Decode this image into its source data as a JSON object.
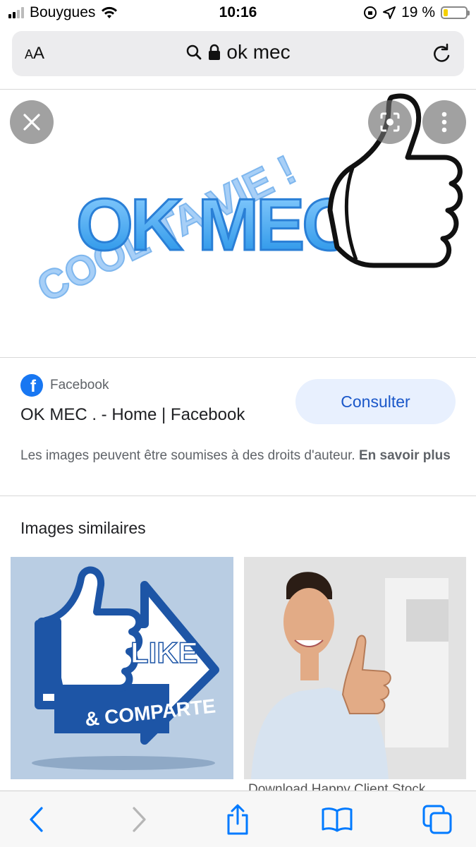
{
  "status_bar": {
    "carrier": "Bouygues",
    "time": "10:16",
    "battery_text": "19 %",
    "battery_level": 0.19
  },
  "url_bar": {
    "text_size_label": "AA",
    "query": "ok mec"
  },
  "hero_image": {
    "logo_text_main": "OK MEC.",
    "logo_text_arc": "COOL TA VIE !"
  },
  "result": {
    "source": "Facebook",
    "title": "OK MEC . - Home | Facebook",
    "consult_label": "Consulter",
    "rights_text": "Les images peuvent être soumises à des droits d'auteur.",
    "learn_more": "En savoir plus"
  },
  "similar": {
    "heading": "Images similaires",
    "items": [
      {
        "like": "LIKE",
        "share": "& COMPARTE"
      },
      {
        "caption": "Download Happy Client Stock"
      }
    ]
  },
  "colors": {
    "accent": "#1a57c9",
    "consult_bg": "#e8f0fe",
    "facebook": "#1877f2",
    "ios_blue": "#007aff"
  },
  "icons": [
    "wifi-icon",
    "location-icon",
    "orientation-lock-icon",
    "search-icon",
    "lock-icon",
    "reload-icon",
    "close-icon",
    "lens-icon",
    "more-icon",
    "back-icon",
    "forward-icon",
    "share-icon",
    "bookmarks-icon",
    "tabs-icon"
  ]
}
